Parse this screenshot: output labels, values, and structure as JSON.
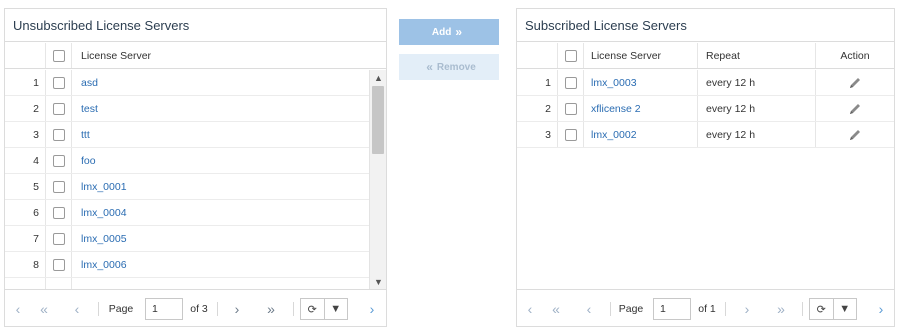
{
  "unsubscribed": {
    "title": "Unsubscribed License Servers",
    "column_header": "License Server",
    "rows": [
      {
        "num": "1",
        "name": "asd"
      },
      {
        "num": "2",
        "name": "test"
      },
      {
        "num": "3",
        "name": "ttt"
      },
      {
        "num": "4",
        "name": "foo"
      },
      {
        "num": "5",
        "name": "lmx_0001"
      },
      {
        "num": "6",
        "name": "lmx_0004"
      },
      {
        "num": "7",
        "name": "lmx_0005"
      },
      {
        "num": "8",
        "name": "lmx_0006"
      }
    ],
    "pager": {
      "page_label": "Page",
      "page_value": "1",
      "of_label": "of 3"
    }
  },
  "transfer": {
    "add_label": "Add",
    "remove_label": "Remove"
  },
  "subscribed": {
    "title": "Subscribed License Servers",
    "col_server": "License Server",
    "col_repeat": "Repeat",
    "col_action": "Action",
    "rows": [
      {
        "num": "1",
        "name": "lmx_0003",
        "repeat": "every 12 h"
      },
      {
        "num": "2",
        "name": "xflicense 2",
        "repeat": "every 12 h"
      },
      {
        "num": "3",
        "name": "lmx_0002",
        "repeat": "every 12 h"
      }
    ],
    "pager": {
      "page_label": "Page",
      "page_value": "1",
      "of_label": "of 1"
    }
  },
  "icons": {
    "first": "first-page-icon",
    "prev": "prev-page-icon",
    "next": "next-page-icon",
    "last": "last-page-icon",
    "refresh": "refresh-icon",
    "dropdown": "caret-down-icon",
    "expand": "chevron-right-icon",
    "edit": "pencil-icon"
  },
  "colors": {
    "accent": "#2a6cb2",
    "add_button": "#9dc2e6",
    "remove_button": "#e3eef8"
  }
}
